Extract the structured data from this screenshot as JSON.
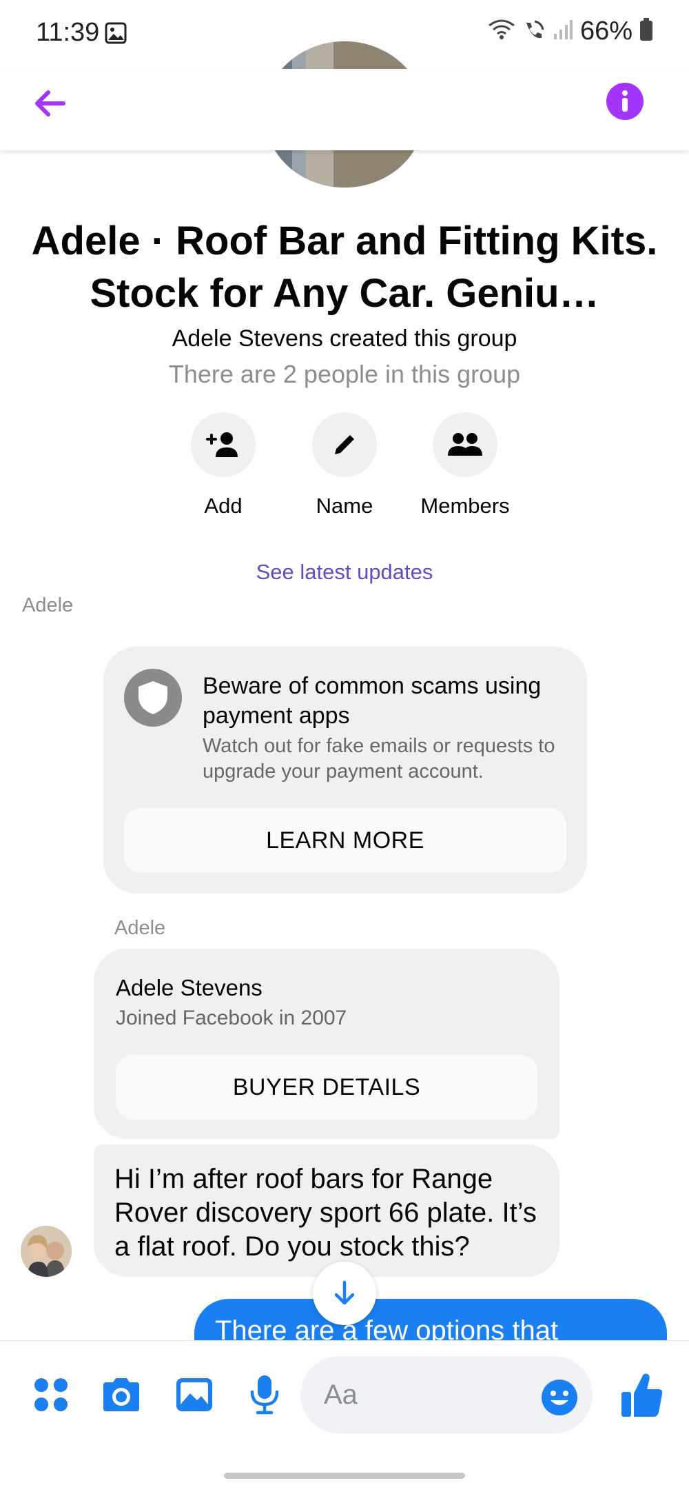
{
  "status_bar": {
    "time": "11:39",
    "battery": "66%",
    "icons": [
      "image-icon",
      "wifi-icon",
      "wifi-call-icon",
      "signal-icon",
      "battery-icon"
    ]
  },
  "header": {
    "back_icon": "back-arrow-icon",
    "info_icon": "info-icon",
    "accent_color": "#a334fa"
  },
  "group": {
    "title": "Adele · Roof Bar and Fitting Kits. Stock for Any Car. Geniu…",
    "created_by": "Adele Stevens created this group",
    "member_count_text": "There are 2 people in this group",
    "actions": [
      {
        "label": "Add",
        "icon": "add-person-icon"
      },
      {
        "label": "Name",
        "icon": "pencil-icon"
      },
      {
        "label": "Members",
        "icon": "members-icon"
      }
    ],
    "see_updates": "See latest updates"
  },
  "messages": {
    "sender_label_1": "Adele",
    "scam_card": {
      "title": "Beware of common scams using payment apps",
      "description": "Watch out for fake emails or requests to upgrade your payment account.",
      "button": "LEARN MORE",
      "icon": "shield-icon"
    },
    "sender_label_2": "Adele",
    "profile_card": {
      "name": "Adele Stevens",
      "joined": "Joined Facebook in 2007",
      "button": "BUYER DETAILS"
    },
    "incoming_text": "Hi I’m after roof bars for Range Rover discovery sport 66 plate. It’s a flat roof. Do you stock this?",
    "outgoing_text": "There are a few options that"
  },
  "composer": {
    "placeholder": "Aa",
    "icons": [
      "menu-dots-icon",
      "camera-icon",
      "gallery-icon",
      "microphone-icon",
      "emoji-icon",
      "thumbs-up-icon"
    ],
    "accent_color": "#1a7ff0"
  }
}
